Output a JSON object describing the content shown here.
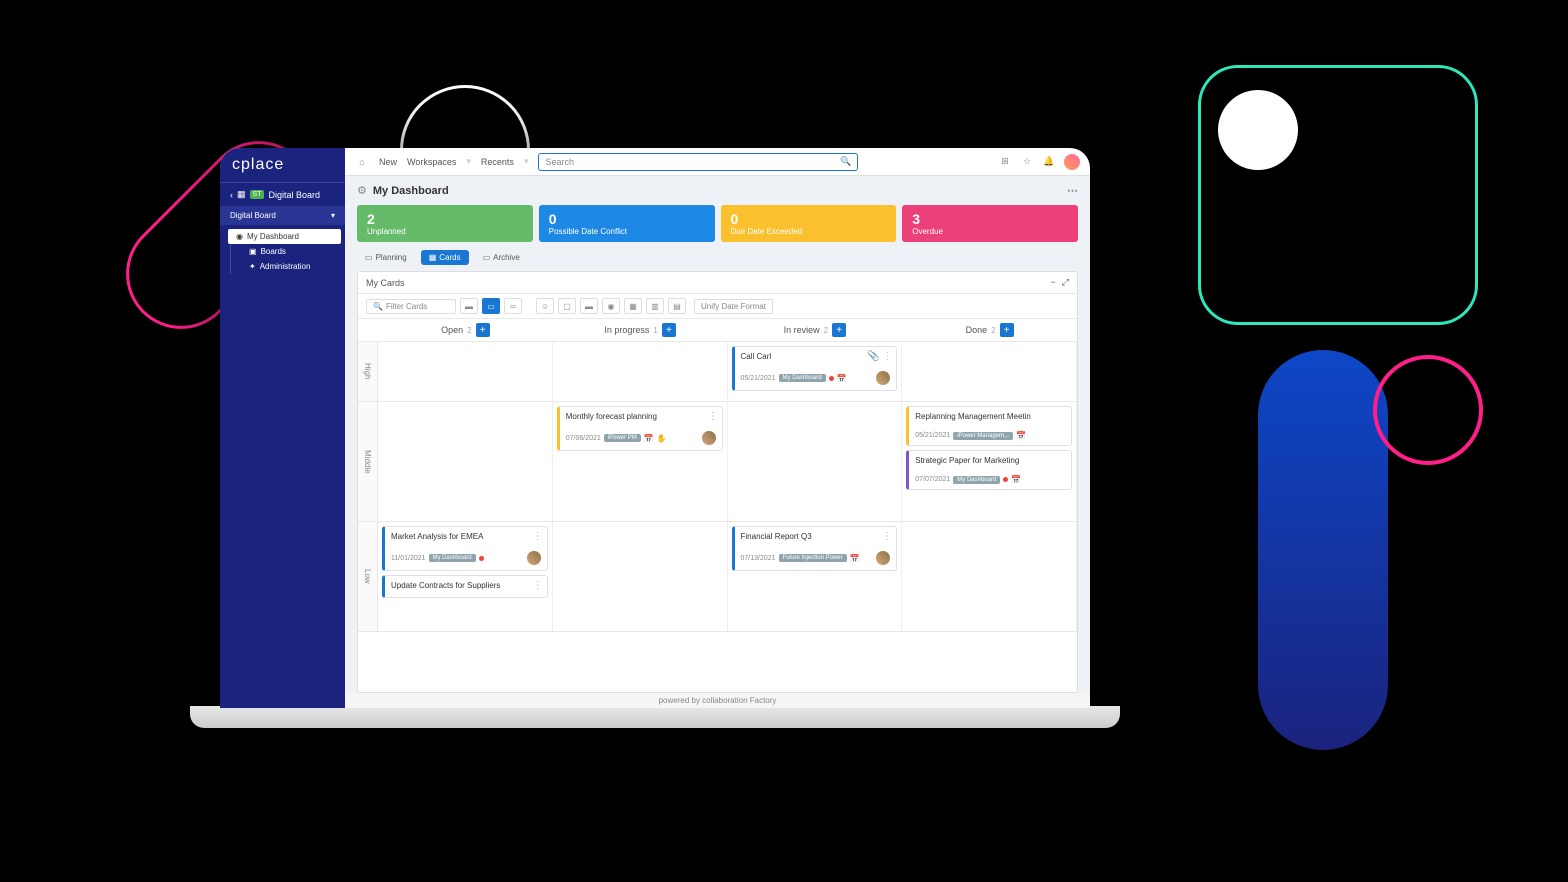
{
  "brand": "cplace",
  "nav": {
    "new": "New",
    "workspaces": "Workspaces",
    "recents": "Recents",
    "search_placeholder": "Search"
  },
  "sidebar": {
    "badge": "ST",
    "title": "Digital Board",
    "section": "Digital Board",
    "items": [
      {
        "label": "My Dashboard",
        "active": true
      },
      {
        "label": "Boards",
        "active": false
      },
      {
        "label": "Administration",
        "active": false
      }
    ]
  },
  "page": {
    "title": "My Dashboard"
  },
  "stats": [
    {
      "value": "2",
      "label": "Unplanned"
    },
    {
      "value": "0",
      "label": "Possible Date Conflict"
    },
    {
      "value": "0",
      "label": "Due Date Exceeded"
    },
    {
      "value": "3",
      "label": "Overdue"
    }
  ],
  "tabs": [
    {
      "label": "Planning"
    },
    {
      "label": "Cards"
    },
    {
      "label": "Archive"
    }
  ],
  "board": {
    "title": "My Cards",
    "filter_placeholder": "Filter Cards",
    "unify": "Unify Date Format",
    "columns": [
      {
        "name": "Open",
        "count": "2"
      },
      {
        "name": "In progress",
        "count": "1"
      },
      {
        "name": "In review",
        "count": "2"
      },
      {
        "name": "Done",
        "count": "2"
      }
    ],
    "rows": [
      {
        "label": "High"
      },
      {
        "label": "Middle"
      },
      {
        "label": "Low"
      }
    ]
  },
  "cards": {
    "call_carl": {
      "title": "Call Carl",
      "date": "05/21/2021",
      "tag": "My Dashboard"
    },
    "forecast": {
      "title": "Monthly forecast planning",
      "date": "07/06/2021",
      "tag": "iPower PM"
    },
    "replanning": {
      "title": "Replanning Management Meetin",
      "date": "05/21/2021",
      "tag": "iPower Managem..."
    },
    "strategic": {
      "title": "Strategic Paper for Marketing",
      "date": "07/07/2021",
      "tag": "My Dashboard"
    },
    "market": {
      "title": "Market Analysis for EMEA",
      "date": "11/01/2021",
      "tag": "My Dashboard"
    },
    "financial": {
      "title": "Financial Report Q3",
      "date": "07/13/2021",
      "tag": "Future Injection Power"
    },
    "contracts": {
      "title": "Update Contracts for Suppliers"
    }
  },
  "footer": "powered by collaboration Factory"
}
